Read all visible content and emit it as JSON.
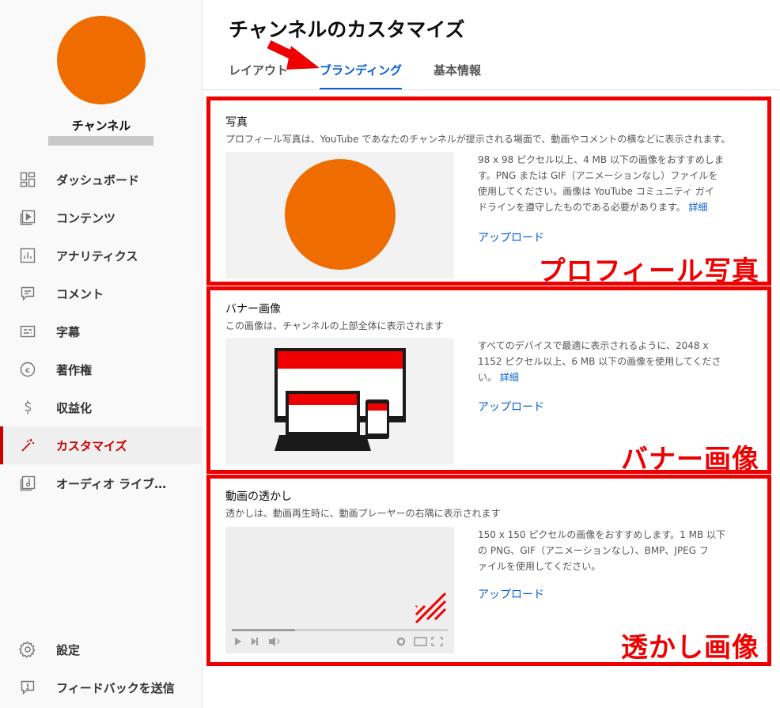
{
  "sidebar": {
    "channel_name": "チャンネル",
    "items": [
      {
        "label": "ダッシュボード",
        "icon": "dashboard-icon"
      },
      {
        "label": "コンテンツ",
        "icon": "content-icon"
      },
      {
        "label": "アナリティクス",
        "icon": "analytics-icon"
      },
      {
        "label": "コメント",
        "icon": "comment-icon"
      },
      {
        "label": "字幕",
        "icon": "subtitles-icon"
      },
      {
        "label": "著作権",
        "icon": "copyright-icon"
      },
      {
        "label": "収益化",
        "icon": "dollar-icon"
      },
      {
        "label": "カスタマイズ",
        "icon": "magic-wand-icon"
      },
      {
        "label": "オーディオ ライブ…",
        "icon": "audio-library-icon"
      }
    ],
    "active_index": 7,
    "bottom_items": [
      {
        "label": "設定",
        "icon": "gear-icon"
      },
      {
        "label": "フィードバックを送信",
        "icon": "feedback-icon"
      }
    ]
  },
  "header": {
    "title": "チャンネルのカスタマイズ",
    "tabs": [
      "レイアウト",
      "ブランディング",
      "基本情報"
    ],
    "active_tab": 1
  },
  "sections": {
    "photo": {
      "title": "写真",
      "description": "プロフィール写真は、YouTube であなたのチャンネルが提示される場面で、動画やコメントの横などに表示されます。",
      "info_lines": [
        "98 x 98 ピクセル以上、4 MB 以下の画像をおすすめしま",
        "す。PNG または GIF（アニメーションなし）ファイルを",
        "使用してください。画像は YouTube コミュニティ ガイ",
        "ドラインを遵守したものである必要があります。"
      ],
      "more": "詳細",
      "upload": "アップロード",
      "overlay": "プロフィール写真"
    },
    "banner": {
      "title": "バナー画像",
      "description": "この画像は、チャンネルの上部全体に表示されます",
      "info_lines": [
        "すべてのデバイスで最適に表示されるように、2048 x",
        "1152 ピクセル以上、6 MB 以下の画像を使用してくださ",
        "い。"
      ],
      "more": "詳細",
      "upload": "アップロード",
      "overlay": "バナー画像"
    },
    "watermark": {
      "title": "動画の透かし",
      "description": "透かしは、動画再生時に、動画プレーヤーの右隅に表示されます",
      "info_lines": [
        "150 x 150 ピクセルの画像をおすすめします。1 MB 以下",
        "の PNG、GIF（アニメーションなし）、BMP、JPEG フ",
        "ァイルを使用してください。"
      ],
      "upload": "アップロード",
      "overlay": "透かし画像"
    }
  },
  "colors": {
    "accent_red": "#ee0000",
    "avatar_orange": "#ef6c00",
    "link_blue": "#065fd4"
  }
}
